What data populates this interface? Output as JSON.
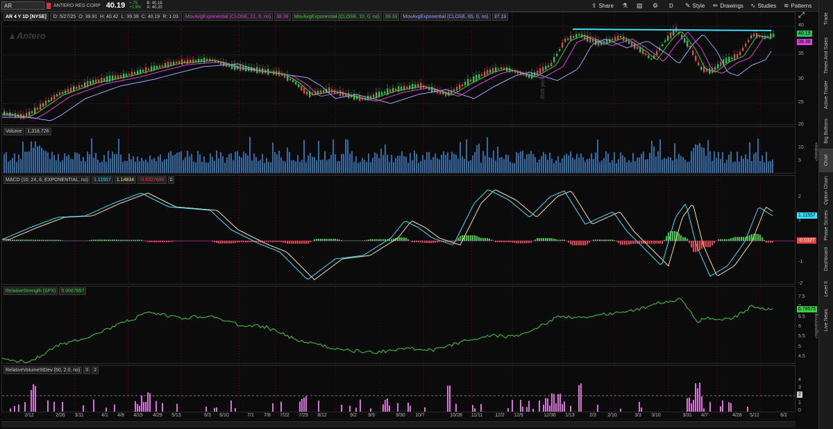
{
  "header": {
    "symbol": "AR",
    "company": "ANTERO RES CORP",
    "last": "40.19",
    "change": "+.75",
    "change_pct": "+1.9%",
    "bid": "B: 40.18",
    "ask": "A: 40.20"
  },
  "toolbar": {
    "share": "Share",
    "timeframe": "D",
    "style": "Style",
    "drawings": "Drawings",
    "studies": "Studies",
    "patterns": "Patterns"
  },
  "sidebar": [
    "Trade",
    "Times And Sales",
    "Active Trader",
    "Big Buttons",
    "Chart",
    "Option Chain",
    "Phase Scores",
    "Dashboard",
    "Level II",
    "Live News"
  ],
  "price_panel": {
    "title": "AR 4 Y 1D [NYSE]",
    "ohlc": [
      "D: 5/27/25",
      "O: 39.91",
      "H: 40.42",
      "L: 39.39",
      "C: 40.19",
      "R: 1.03"
    ],
    "studies": [
      {
        "label": "MovAvgExponential (CLOSE, 21, 0, no)",
        "value": "38.39",
        "color": "#e040e0"
      },
      {
        "label": "MovAvgExponential (CLOSE, 10, 0, no)",
        "value": "39.33",
        "color": "#3ad13a"
      },
      {
        "label": "MovAvgExponential (CLOSE, 65, 0, no)",
        "value": "37.19",
        "color": "#9aa7ff"
      }
    ],
    "yaxis": [
      "40",
      "35",
      "30",
      "25",
      "20"
    ],
    "last_badge": "40.19",
    "ema21_badge": "38.39",
    "watermark": "Antero",
    "year_marker": "2025 year",
    "colors": {
      "up": "#22c55e",
      "down": "#ef4444",
      "ema10": "#3ad13a",
      "ema21": "#e040e0",
      "ema65": "#9aa7ff",
      "trendline": "#3ce0ff"
    }
  },
  "volume_panel": {
    "label": "Volume",
    "value": "1,318,726",
    "yaxis": [
      "10",
      "5"
    ],
    "unit": "<millions>",
    "color": "#2c6ea8"
  },
  "macd_panel": {
    "label": "MACD (10, 24, 6, EXPONENTIAL, no)",
    "v1": "1.11557",
    "v2": "1.14834",
    "v3": "-0.0327696",
    "v4": "0",
    "yaxis": [
      "2",
      "1",
      "-1",
      "-2"
    ],
    "badge1": "1.11557",
    "badge2": "-0.0327"
  },
  "rs_panel": {
    "label": "RelativeStrength (SPX)",
    "value": "0.0067857",
    "yaxis": [
      "7.5",
      "7",
      "6.5",
      "6",
      "5.5",
      "5",
      "4.5"
    ],
    "unit": "<thousandths>",
    "badge": "6.78575"
  },
  "rv_panel": {
    "label": "RelativeVolumeStDev (60, 2.0, no)",
    "v1": "0",
    "v2": "2",
    "yaxis": [
      "4",
      "3",
      "2",
      "1",
      "0"
    ],
    "badge": "2"
  },
  "dates": [
    "2/12",
    "2/26",
    "3/11",
    "4/1",
    "4/8",
    "4/15",
    "4/29",
    "5/13",
    "6/3",
    "6/10",
    "7/1",
    "7/8",
    "7/22",
    "7/29",
    "8/12",
    "9/2",
    "9/9",
    "9/30",
    "10/7",
    "10/28",
    "11/11",
    "12/2",
    "12/9",
    "12/30",
    "1/13",
    "2/3",
    "2/10",
    "3/3",
    "3/10",
    "3/31",
    "4/7",
    "4/28",
    "5/12",
    "6/2"
  ]
}
